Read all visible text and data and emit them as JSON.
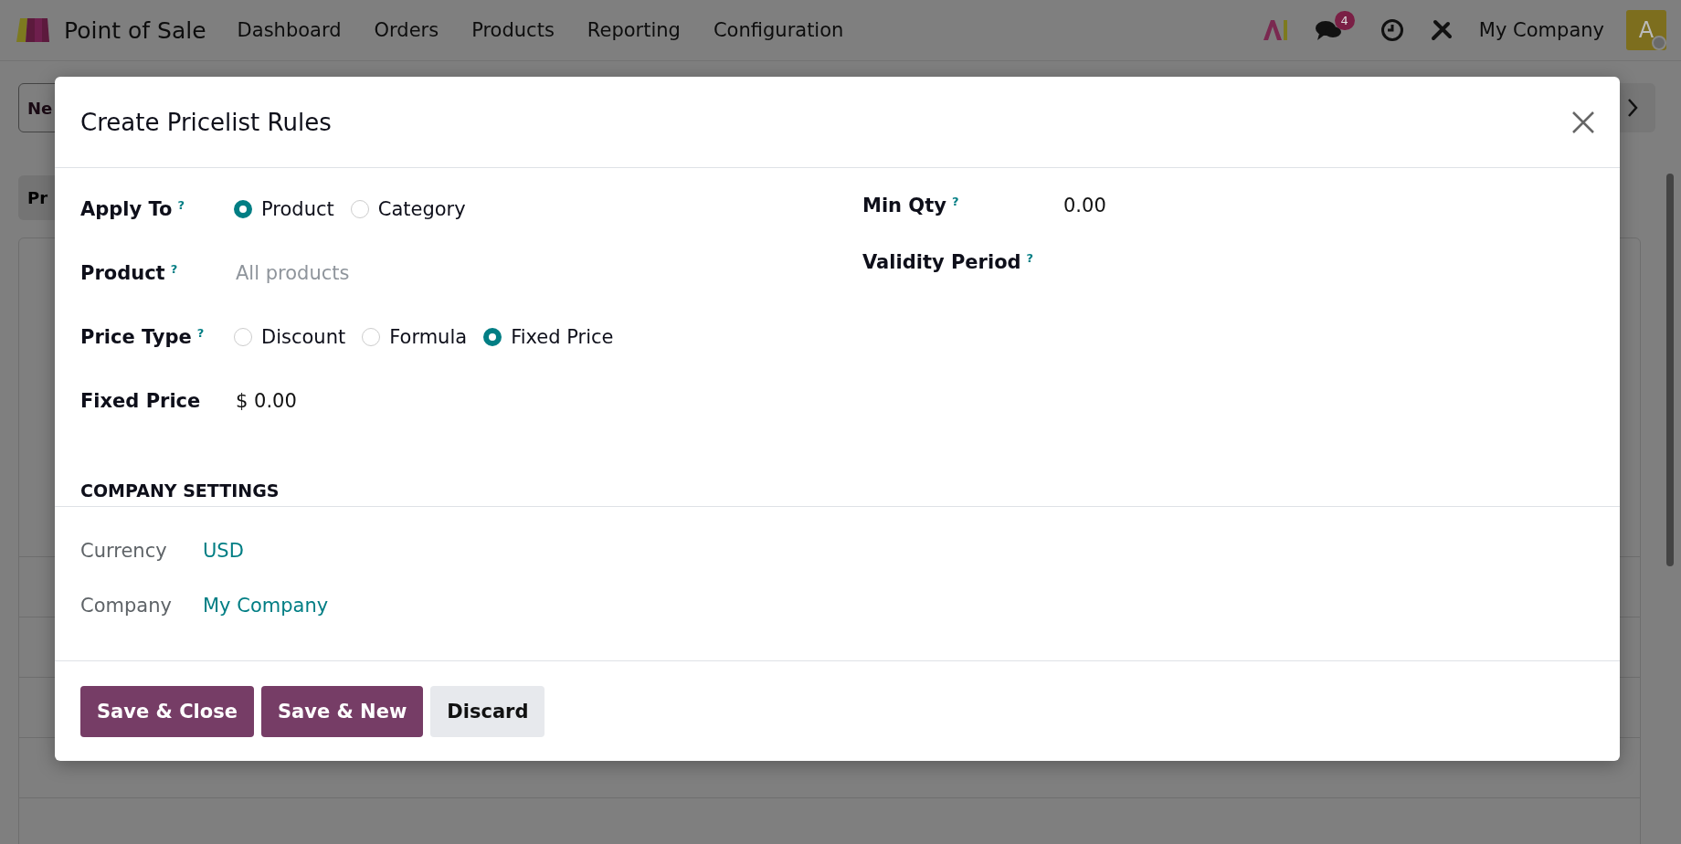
{
  "navbar": {
    "app_name": "Point of Sale",
    "menu": [
      "Dashboard",
      "Orders",
      "Products",
      "Reporting",
      "Configuration"
    ],
    "message_count": "4",
    "company": "My Company",
    "avatar_letter": "A"
  },
  "background": {
    "new_button": "Ne",
    "tab": "Pr"
  },
  "dialog": {
    "title": "Create Pricelist Rules",
    "left_fields": [
      {
        "kind": "radio",
        "label": "Apply To",
        "help": "?",
        "options": [
          {
            "label": "Product",
            "selected": true
          },
          {
            "label": "Category",
            "selected": false
          }
        ]
      },
      {
        "kind": "placeholder",
        "label": "Product",
        "help": "?",
        "placeholder": "All products"
      },
      {
        "kind": "radio",
        "label": "Price Type",
        "help": "?",
        "options": [
          {
            "label": "Discount",
            "selected": false
          },
          {
            "label": "Formula",
            "selected": false
          },
          {
            "label": "Fixed Price",
            "selected": true
          }
        ]
      },
      {
        "kind": "value",
        "label": "Fixed Price",
        "value": "$ 0.00"
      }
    ],
    "right_fields": [
      {
        "kind": "value",
        "label": "Min Qty",
        "help": "?",
        "value": "0.00"
      },
      {
        "kind": "empty",
        "label": "Validity Period",
        "help": "?"
      }
    ],
    "section_title": "COMPANY SETTINGS",
    "company_fields": [
      {
        "label": "Currency",
        "value": "USD"
      },
      {
        "label": "Company",
        "value": "My Company"
      }
    ],
    "buttons": [
      {
        "label": "Save & Close",
        "kind": "primary"
      },
      {
        "label": "Save & New",
        "kind": "primary"
      },
      {
        "label": "Discard",
        "kind": "secondary"
      }
    ]
  }
}
